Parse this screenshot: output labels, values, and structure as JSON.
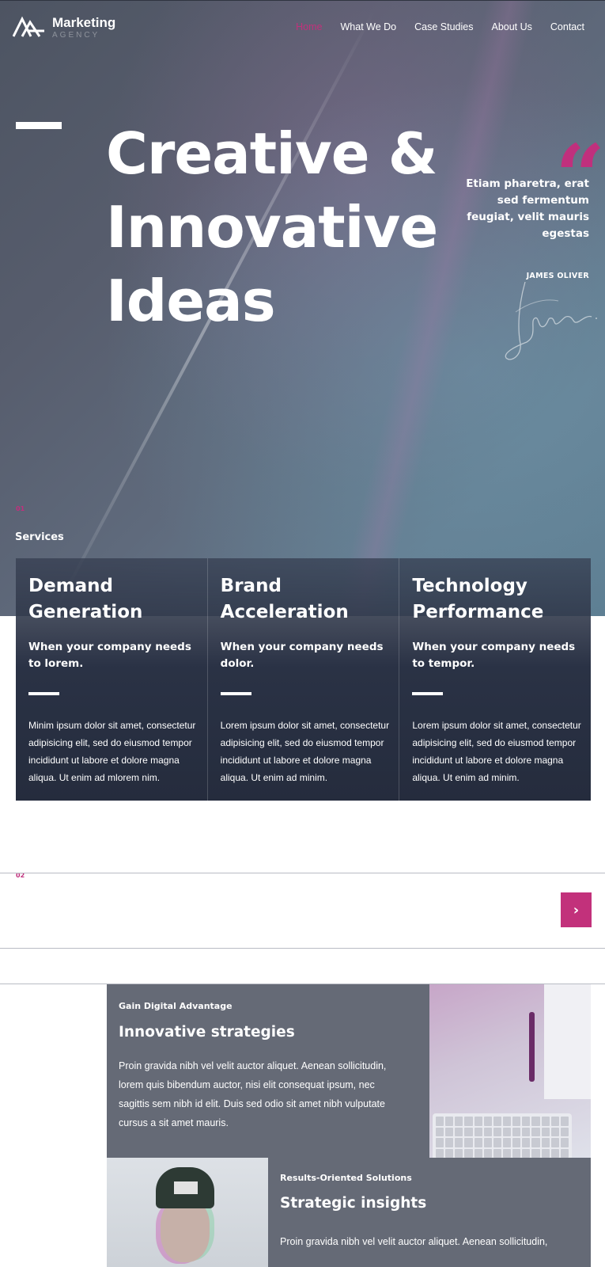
{
  "brand": {
    "name": "Marketing",
    "tagline": "AGENCY"
  },
  "nav": {
    "items": [
      {
        "label": "Home",
        "active": true
      },
      {
        "label": "What We Do",
        "active": false
      },
      {
        "label": "Case Studies",
        "active": false
      },
      {
        "label": "About Us",
        "active": false
      },
      {
        "label": "Contact",
        "active": false
      }
    ]
  },
  "hero": {
    "title": "Creative & Innovative Ideas",
    "quote": "Etiam pharetra, erat sed fermentum feugiat, velit mauris egestas",
    "quote_author": "JAMES OLIVER",
    "section_number": "01",
    "section_label": "Services"
  },
  "services": [
    {
      "title": "Demand Generation",
      "subtitle": "When your company needs to lorem.",
      "body": "Minim ipsum dolor sit amet, consectetur adipisicing elit, sed do eiusmod tempor incididunt ut labore et dolore magna aliqua. Ut enim ad mlorem nim."
    },
    {
      "title": "Brand Acceleration",
      "subtitle": "When your company needs dolor.",
      "body": "Lorem ipsum dolor sit amet, consectetur adipisicing elit, sed do eiusmod tempor incididunt ut labore et dolore magna aliqua. Ut enim ad minim."
    },
    {
      "title": "Technology Performance",
      "subtitle": "When your company needs to tempor.",
      "body": "Lorem ipsum dolor sit amet, consectetur adipisicing elit, sed do eiusmod tempor incididunt ut labore et dolore magna aliqua. Ut enim ad minim."
    }
  ],
  "section2": {
    "number": "02",
    "next_icon": "chevron-right-icon"
  },
  "features": [
    {
      "kicker": "Gain Digital Advantage",
      "title": "Innovative strategies",
      "body": "Proin gravida nibh vel velit auctor aliquet. Aenean sollicitudin, lorem quis bibendum auctor, nisi elit consequat ipsum, nec sagittis sem nibh id elit. Duis sed odio sit amet nibh vulputate cursus a sit amet mauris."
    },
    {
      "kicker": "Results-Oriented Solutions",
      "title": "Strategic insights",
      "body": "Proin gravida nibh vel velit auctor aliquet. Aenean sollicitudin,"
    }
  ],
  "colors": {
    "accent": "#c2317b",
    "card_bg": "#252c3d",
    "feature_bg": "#656a76"
  }
}
